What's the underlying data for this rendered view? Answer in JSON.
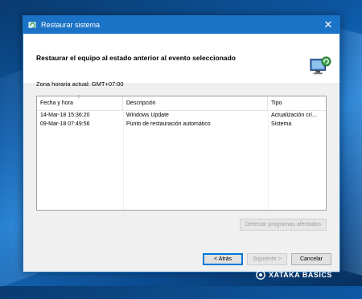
{
  "window": {
    "title": "Restaurar sistema"
  },
  "header": {
    "heading": "Restaurar el equipo al estado anterior al evento seleccionado"
  },
  "timezone_label": "Zona horaria actual: GMT+07:00",
  "table": {
    "columns": [
      "Fecha y hora",
      "Descripción",
      "Tipo"
    ],
    "rows": [
      [
        "14-Mar-18 15:36:20",
        "Windows Update",
        "Actualización crí..."
      ],
      [
        "09-Mar-18 07:49:56",
        "Punto de restauración automático",
        "Sistema"
      ]
    ]
  },
  "buttons": {
    "scan": "Detectar programas afectados",
    "back": "< Atrás",
    "next": "Siguiente >",
    "cancel": "Cancelar"
  },
  "watermark": "XATAKA BASICS",
  "colors": {
    "titlebar": "#1a73c6",
    "accent": "#0078d7"
  }
}
